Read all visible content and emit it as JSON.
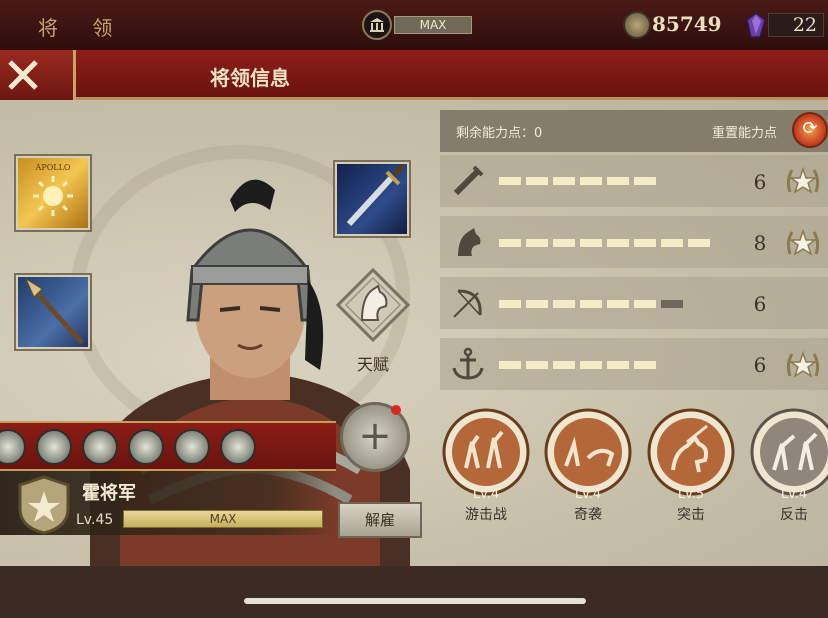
{
  "header": {
    "title": "将 领",
    "building_level": "MAX",
    "gold": "85749",
    "gems": "22"
  },
  "banner": {
    "title": "将领信息"
  },
  "equipment": {
    "banner_text": "APOLLO",
    "talent_label": "天赋"
  },
  "general": {
    "name": "霍将军",
    "level": "Lv.45",
    "level_status": "MAX",
    "dismiss_label": "解雇"
  },
  "stats": {
    "remaining_label": "剩余能力点：0",
    "reset_label": "重置能力点",
    "rows": [
      {
        "icon": "sword-icon",
        "value": "6",
        "filled": 6,
        "max": 6,
        "starred": true
      },
      {
        "icon": "horse-icon",
        "value": "8",
        "filled": 8,
        "max": 8,
        "starred": true
      },
      {
        "icon": "bow-icon",
        "value": "6",
        "filled": 6,
        "max": 7,
        "starred": false
      },
      {
        "icon": "anchor-icon",
        "value": "6",
        "filled": 6,
        "max": 6,
        "starred": true
      }
    ]
  },
  "skills": [
    {
      "level": "Lv.4",
      "name": "游击战",
      "active": true
    },
    {
      "level": "Lv.4",
      "name": "奇袭",
      "active": true
    },
    {
      "level": "Lv.5",
      "name": "突击",
      "active": true
    },
    {
      "level": "Lv.4",
      "name": "反击",
      "active": false
    }
  ],
  "colors": {
    "segment_active": "#f3ecc6",
    "segment_inactive": "#6d685b",
    "skill_active_ring": "#6a3c1a",
    "skill_inactive_ring": "#5a5448"
  }
}
